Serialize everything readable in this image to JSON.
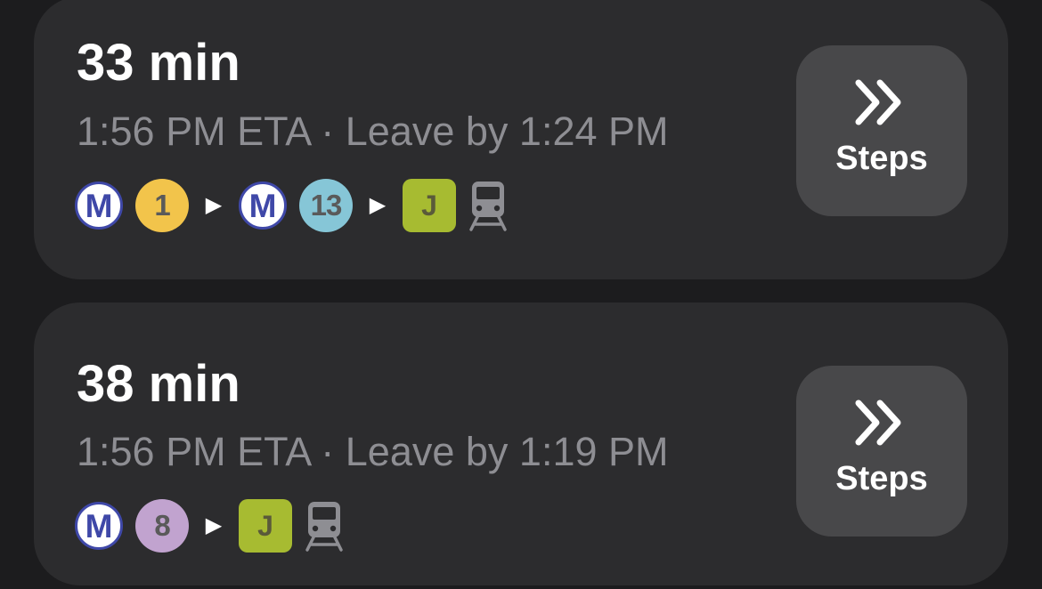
{
  "routes": [
    {
      "duration": "33 min",
      "eta": "1:56 PM ETA · Leave by 1:24 PM",
      "steps_label": "Steps",
      "legs": [
        {
          "metro_label": "M",
          "line": "1",
          "line_color": "#f2c44b"
        },
        {
          "metro_label": "M",
          "line": "13",
          "line_color": "#86c6d7"
        }
      ],
      "rer": {
        "label": "J",
        "color": "#a7bb31"
      }
    },
    {
      "duration": "38 min",
      "eta": "1:56 PM ETA · Leave by 1:19 PM",
      "steps_label": "Steps",
      "legs": [
        {
          "metro_label": "M",
          "line": "8",
          "line_color": "#c1a3cf"
        }
      ],
      "rer": {
        "label": "J",
        "color": "#a7bb31"
      }
    }
  ],
  "icons": {
    "arrow": "▶",
    "steps": "chevron-double-right-icon",
    "train": "train-icon"
  },
  "colors": {
    "background": "#1c1c1e",
    "card": "#2c2c2e",
    "button": "#48484a",
    "metro_ring": "#3f48a8",
    "secondary_text": "#8e8e93"
  }
}
